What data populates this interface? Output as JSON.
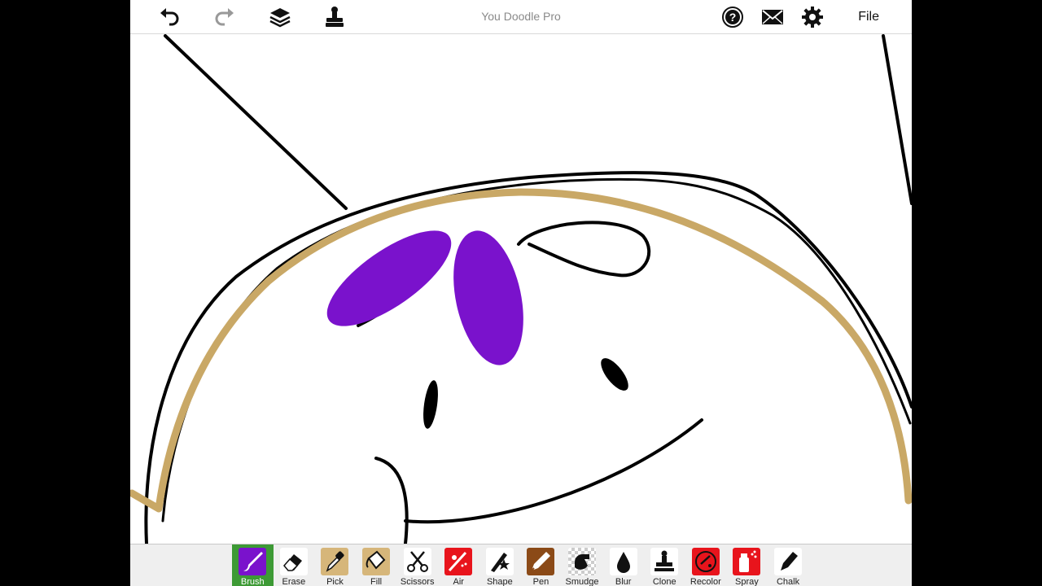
{
  "app": {
    "title": "You Doodle Pro",
    "file_label": "File"
  },
  "icons": {
    "undo": "undo-icon",
    "redo": "redo-icon",
    "layers": "layers-icon",
    "stamp": "stamp-icon",
    "help": "help-icon",
    "mail": "mail-icon",
    "settings": "gear-icon"
  },
  "colors": {
    "active_tool": "#3d9a35",
    "brush": "#7a12cc",
    "tan_stroke": "#c9a866",
    "ink": "#000000"
  },
  "tools": [
    {
      "label": "Brush",
      "name": "tool-brush",
      "color": "#7a12cc",
      "active": true
    },
    {
      "label": "Erase",
      "name": "tool-erase",
      "color": "#ffffff"
    },
    {
      "label": "Pick",
      "name": "tool-pick",
      "color": "#d6b67a"
    },
    {
      "label": "Fill",
      "name": "tool-fill",
      "color": "#d6b67a"
    },
    {
      "label": "Scissors",
      "name": "tool-scissors",
      "color": "#ffffff"
    },
    {
      "label": "Air",
      "name": "tool-air",
      "color": "#e8141c"
    },
    {
      "label": "Shape",
      "name": "tool-shape",
      "color": "#ffffff"
    },
    {
      "label": "Pen",
      "name": "tool-pen",
      "color": "#8b4a17"
    },
    {
      "label": "Smudge",
      "name": "tool-smudge",
      "color": "checker"
    },
    {
      "label": "Blur",
      "name": "tool-blur",
      "color": "#ffffff"
    },
    {
      "label": "Clone",
      "name": "tool-clone",
      "color": "#ffffff"
    },
    {
      "label": "Recolor",
      "name": "tool-recolor",
      "color": "#e8141c"
    },
    {
      "label": "Spray",
      "name": "tool-spray",
      "color": "#e8141c"
    },
    {
      "label": "Chalk",
      "name": "tool-chalk",
      "color": "#ffffff"
    }
  ]
}
